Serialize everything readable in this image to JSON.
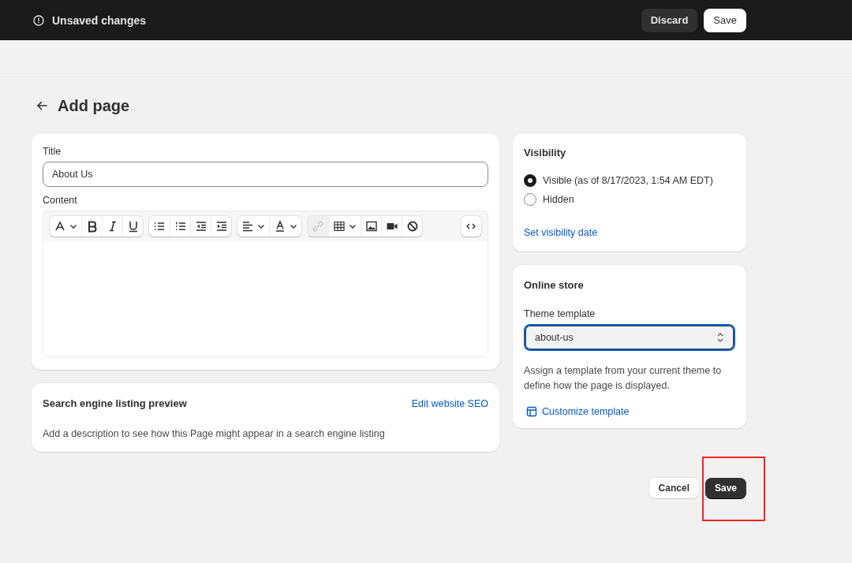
{
  "top_bar": {
    "status": "Unsaved changes",
    "buttons": [
      {
        "label": "Discard",
        "kind": "secondary"
      },
      {
        "label": "Save",
        "kind": "primary"
      }
    ]
  },
  "page": {
    "title": "Add page"
  },
  "content_card": {
    "title_label": "Title",
    "title_value": "About Us",
    "content_label": "Content",
    "toolbar": [
      [
        {
          "kind": "font",
          "dropdown": true,
          "disabled": false
        },
        {
          "kind": "bold",
          "dropdown": false,
          "disabled": false
        },
        {
          "kind": "italic",
          "dropdown": false,
          "disabled": false
        },
        {
          "kind": "underline",
          "dropdown": false,
          "disabled": false
        }
      ],
      [
        {
          "kind": "bullets",
          "dropdown": false,
          "disabled": false
        },
        {
          "kind": "numbers",
          "dropdown": false,
          "disabled": false
        },
        {
          "kind": "outdent",
          "dropdown": false,
          "disabled": false
        },
        {
          "kind": "indent",
          "dropdown": false,
          "disabled": false
        }
      ],
      [
        {
          "kind": "align",
          "dropdown": true,
          "disabled": false
        },
        {
          "kind": "color",
          "dropdown": true,
          "disabled": false
        }
      ],
      [
        {
          "kind": "link",
          "dropdown": false,
          "disabled": true
        },
        {
          "kind": "table",
          "dropdown": true,
          "disabled": false
        },
        {
          "kind": "image",
          "dropdown": false,
          "disabled": false
        },
        {
          "kind": "video",
          "dropdown": false,
          "disabled": false
        },
        {
          "kind": "clear",
          "dropdown": false,
          "disabled": false
        }
      ],
      [
        {
          "kind": "code",
          "dropdown": false,
          "disabled": false
        }
      ]
    ]
  },
  "seo_card": {
    "title": "Search engine listing preview",
    "link": "Edit website SEO",
    "description": "Add a description to see how this Page might appear in a search engine listing"
  },
  "visibility_card": {
    "title": "Visibility",
    "options": [
      {
        "label": "Visible (as of 8/17/2023, 1:54 AM EDT)",
        "selected": true
      },
      {
        "label": "Hidden",
        "selected": false
      }
    ],
    "link": "Set visibility date"
  },
  "online_store_card": {
    "title": "Online store",
    "template_label": "Theme template",
    "template_value": "about-us",
    "help": "Assign a template from your current theme to define how the page is displayed.",
    "link": "Customize template"
  },
  "footer_buttons": [
    {
      "label": "Cancel",
      "kind": "secondary",
      "highlighted": false
    },
    {
      "label": "Save",
      "kind": "primary",
      "highlighted": true
    }
  ]
}
